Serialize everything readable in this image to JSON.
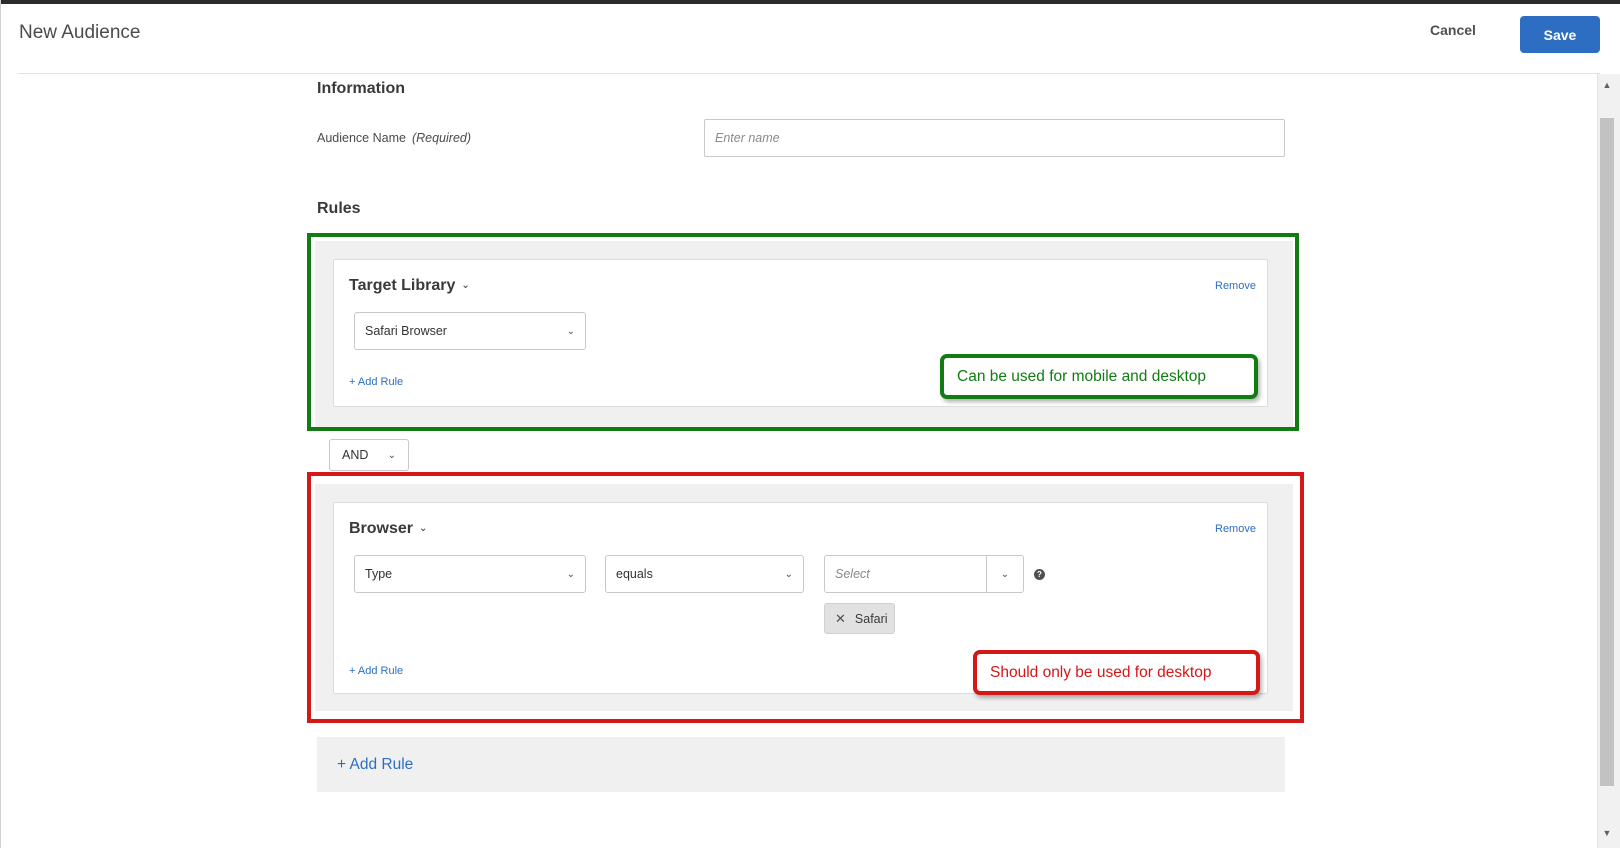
{
  "header": {
    "title": "New Audience",
    "cancel_label": "Cancel",
    "save_label": "Save"
  },
  "information": {
    "heading": "Information",
    "audience_name_label": "Audience Name",
    "required_label": "(Required)",
    "name_placeholder": "Enter name",
    "name_value": ""
  },
  "rules": {
    "heading": "Rules",
    "groups": [
      {
        "name": "Target Library",
        "remove_label": "Remove",
        "selected_value": "Safari Browser",
        "add_rule_label": "+ Add Rule",
        "annotation": "Can be used for mobile and desktop"
      },
      {
        "name": "Browser",
        "remove_label": "Remove",
        "attribute_value": "Type",
        "operator_value": "equals",
        "value_placeholder": "Select",
        "selected_tag": "Safari",
        "add_rule_label": "+ Add Rule",
        "annotation": "Should only be used for desktop"
      }
    ],
    "combinator": "AND",
    "add_rule_label": "+ Add Rule"
  },
  "icons": {
    "chevron": "chevron-down-icon",
    "help": "help-icon",
    "remove_tag": "close-icon"
  },
  "colors": {
    "accent": "#2d6ec3",
    "annotation_green": "#127c12",
    "annotation_red": "#d41717"
  }
}
